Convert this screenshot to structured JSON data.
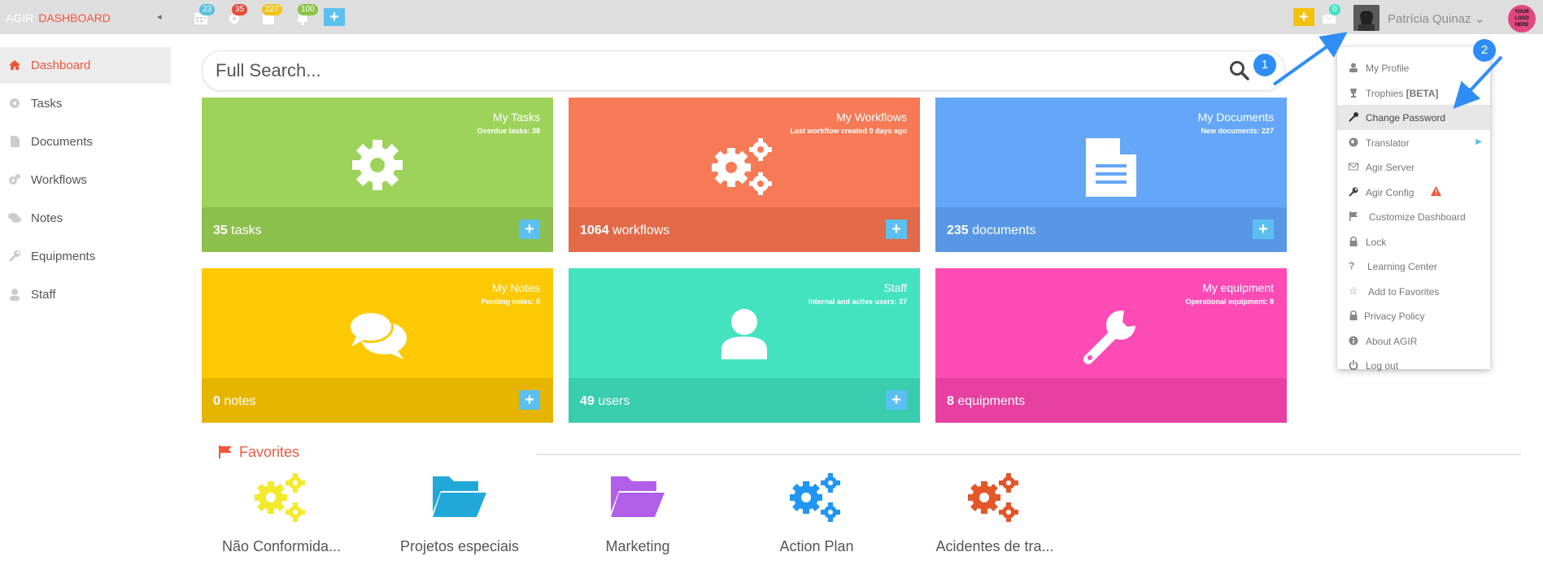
{
  "topbar": {
    "brand_left": "AGIR",
    "brand_right": "DASHBOARD",
    "collapse_glyph": "◂",
    "badges": {
      "calendar": "23",
      "settings": "35",
      "documents": "227",
      "notifications": "100",
      "messages": "0"
    },
    "add_label": "+",
    "user_name": "Patrícia Quinaz",
    "logo_text": "YOUR LOGO HERE"
  },
  "sidebar": {
    "items": [
      {
        "label": "Dashboard",
        "icon": "home-icon"
      },
      {
        "label": "Tasks",
        "icon": "gear-icon"
      },
      {
        "label": "Documents",
        "icon": "document-icon"
      },
      {
        "label": "Workflows",
        "icon": "gears-icon"
      },
      {
        "label": "Notes",
        "icon": "comments-icon"
      },
      {
        "label": "Equipments",
        "icon": "wrench-icon"
      },
      {
        "label": "Staff",
        "icon": "user-icon"
      }
    ]
  },
  "search": {
    "placeholder": "Full Search..."
  },
  "tiles": [
    {
      "title": "My Tasks",
      "subtitle": "Overdue tasks: 38",
      "count": "35",
      "unit": "tasks",
      "color": "#9dd35b",
      "foot": "#8cbf4c"
    },
    {
      "title": "My Workflows",
      "subtitle": "Last workflow created 0 days ago",
      "count": "1064",
      "unit": "workflows",
      "color": "#f67a56",
      "foot": "#e26a48"
    },
    {
      "title": "My Documents",
      "subtitle": "New documents: 227",
      "count": "235",
      "unit": "documents",
      "color": "#64a6f7",
      "foot": "#5897e6"
    },
    {
      "title": "My Notes",
      "subtitle": "Pending notes: 0",
      "count": "0",
      "unit": "notes",
      "color": "#fdc903",
      "foot": "#e6b500"
    },
    {
      "title": "Staff",
      "subtitle": "Internal and active users: 37",
      "count": "49",
      "unit": "users",
      "color": "#43e3c0",
      "foot": "#38cdad"
    },
    {
      "title": "My equipment",
      "subtitle": "Operational equipment: 8",
      "count": "8",
      "unit": "equipments",
      "color": "#fd4bb5",
      "foot": "#e740a0"
    }
  ],
  "favorites": {
    "title": "Favorites",
    "items": [
      {
        "label": "Não Conformida...",
        "icon": "gears-icon",
        "color": "#f2ea2a"
      },
      {
        "label": "Projetos especiais",
        "icon": "folder-icon",
        "color": "#20a8d8"
      },
      {
        "label": "Marketing",
        "icon": "folder-icon",
        "color": "#b15ee8"
      },
      {
        "label": "Action Plan",
        "icon": "gears-icon",
        "color": "#2196f3"
      },
      {
        "label": "Acidentes de tra...",
        "icon": "gears-icon",
        "color": "#e2572a"
      }
    ]
  },
  "user_menu": {
    "items": [
      {
        "label": "My Profile",
        "icon": "user-icon"
      },
      {
        "label": "Trophies",
        "extra": "[BETA]",
        "icon": "trophy-icon"
      },
      {
        "label": "Change Password",
        "icon": "key-icon",
        "highlighted": true
      },
      {
        "label": "Translator",
        "icon": "globe-icon",
        "submenu": true
      },
      {
        "label": "Agir Server",
        "icon": "envelope-icon"
      },
      {
        "label": "Agir Config",
        "icon": "wrench-icon",
        "warning": true
      },
      {
        "label": "Customize Dashboard",
        "icon": "flag-icon"
      },
      {
        "label": "Lock",
        "icon": "lock-icon"
      },
      {
        "label": "Learning Center",
        "icon": "question-icon"
      },
      {
        "label": "Add to Favorites",
        "icon": "star-icon"
      },
      {
        "label": "Privacy Policy",
        "icon": "lock-icon"
      },
      {
        "label": "About AGIR",
        "icon": "info-icon"
      },
      {
        "label": "Log out",
        "icon": "power-icon"
      }
    ]
  },
  "callouts": [
    "1",
    "2"
  ]
}
